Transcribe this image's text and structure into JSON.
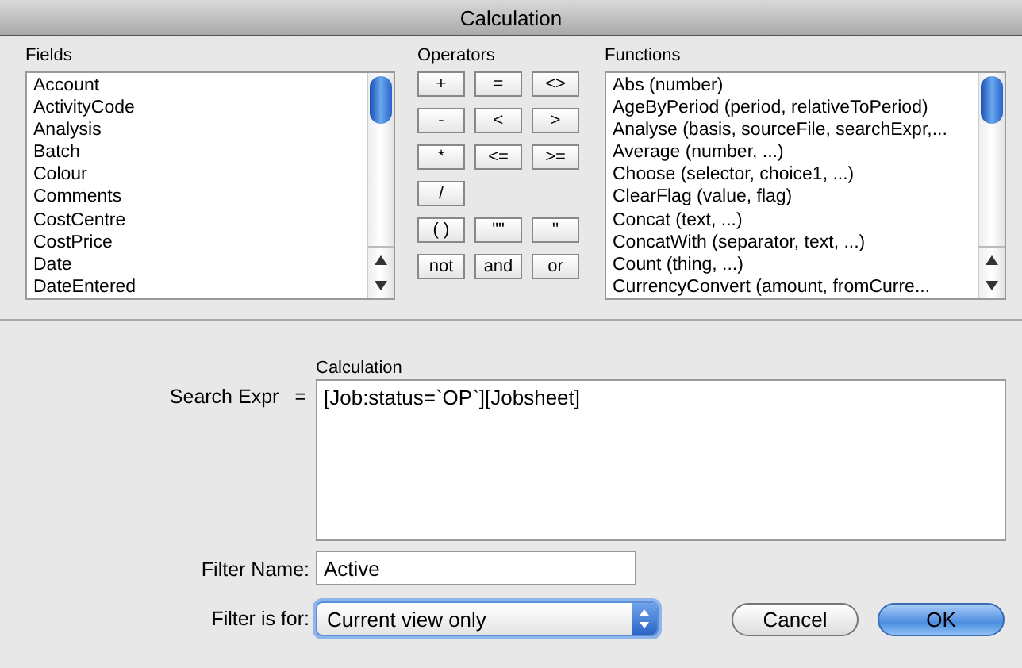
{
  "window": {
    "title": "Calculation"
  },
  "fields": {
    "label": "Fields",
    "items": [
      "Account",
      "ActivityCode",
      "Analysis",
      "Batch",
      "Colour",
      "Comments",
      "CostCentre",
      "CostPrice",
      "Date",
      "DateEntered"
    ]
  },
  "operators": {
    "label": "Operators",
    "rows": [
      [
        "+",
        "=",
        "<>"
      ],
      [
        "-",
        "<",
        ">"
      ],
      [
        "*",
        "<=",
        ">="
      ],
      [
        "/"
      ],
      [
        "( )",
        "\"\"",
        "''"
      ],
      [
        "not",
        "and",
        "or"
      ]
    ]
  },
  "functions": {
    "label": "Functions",
    "items": [
      "Abs (number)",
      "AgeByPeriod (period, relativeToPeriod)",
      "Analyse (basis, sourceFile, searchExpr,...",
      "Average (number, ...)",
      "Choose (selector, choice1, ...)",
      "ClearFlag (value, flag)",
      "Concat (text, ...)",
      "ConcatWith (separator, text, ...)",
      "Count (thing, ...)",
      "CurrencyConvert (amount, fromCurre..."
    ]
  },
  "search_expr": {
    "label": "Search Expr",
    "sign": "=",
    "caption": "Calculation",
    "value": "[Job:status=`OP`][Jobsheet]"
  },
  "filter_name": {
    "label": "Filter Name:",
    "value": "Active"
  },
  "filter_for": {
    "label": "Filter is for:",
    "value": "Current view only"
  },
  "buttons": [
    {
      "label": "Cancel",
      "default": false
    },
    {
      "label": "OK",
      "default": true
    }
  ]
}
